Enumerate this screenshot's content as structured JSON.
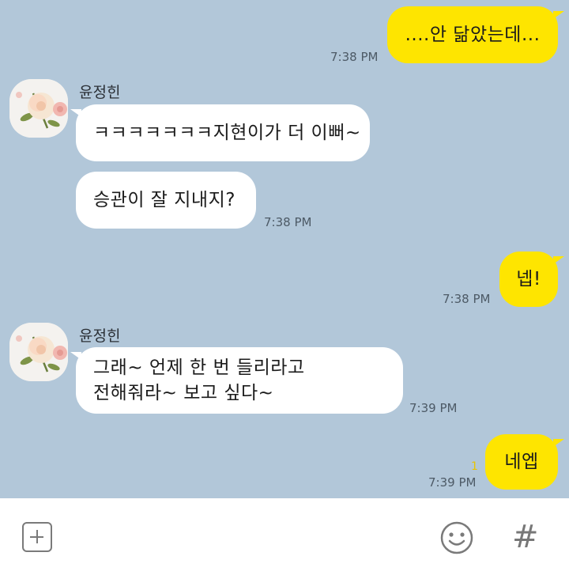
{
  "messages": [
    {
      "text": "....안 닮았는데...",
      "time": "7:38 PM"
    },
    {
      "sender": "윤정힌",
      "text": "ㅋㅋㅋㅋㅋㅋㅋ지현이가 더 이뻐~"
    },
    {
      "text": "승관이 잘 지내지?",
      "time": "7:38 PM"
    },
    {
      "text": "넵!",
      "time": "7:38 PM"
    },
    {
      "sender": "윤정힌",
      "text": "그래~ 언제 한 번 들리라고\n전해줘라~ 보고 싶다~",
      "time": "7:39 PM"
    },
    {
      "text": "네엡",
      "time": "7:39 PM",
      "unread": "1"
    }
  ],
  "input_bar": {
    "hash_label": "#"
  },
  "colors": {
    "background": "#b2c7d9",
    "outgoing": "#fee500",
    "incoming": "#ffffff"
  },
  "icons": [
    "plus-square-icon",
    "emoticon-icon",
    "hash-icon",
    "rose-avatar"
  ]
}
